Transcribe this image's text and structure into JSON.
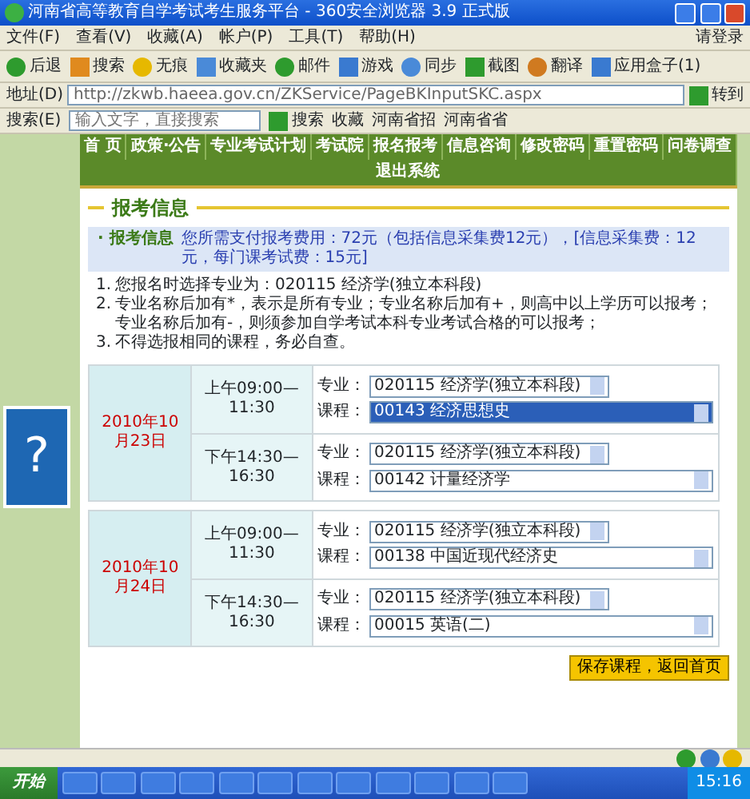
{
  "window": {
    "title": "河南省高等教育自学考试考生服务平台 - 360安全浏览器 3.9 正式版",
    "menu": [
      "文件(F)",
      "查看(V)",
      "收藏(A)",
      "帐户(P)",
      "工具(T)",
      "帮助(H)"
    ],
    "login": "请登录"
  },
  "toolbar": [
    {
      "label": "后退"
    },
    {
      "label": "搜索"
    },
    {
      "label": "无痕"
    },
    {
      "label": "收藏夹"
    },
    {
      "label": "邮件"
    },
    {
      "label": "游戏"
    },
    {
      "label": "同步"
    },
    {
      "label": "截图"
    },
    {
      "label": "翻译"
    },
    {
      "label": "应用盒子(1)"
    }
  ],
  "address": {
    "label": "地址(D)",
    "url": "http://zkwb.haeea.gov.cn/ZKService/PageBKInputSKC.aspx",
    "go": "转到"
  },
  "search_bar": {
    "label": "搜索(E)",
    "placeholder": "输入文字，直接搜索",
    "button": "搜索",
    "links": [
      "收藏",
      "河南省招",
      "河南省省"
    ]
  },
  "nav": [
    "首 页",
    "政策·公告",
    "专业考试计划",
    "考试院",
    "报名报考",
    "信息咨询",
    "修改密码",
    "重置密码",
    "问卷调查",
    "退出系统"
  ],
  "section_title": "报考信息",
  "info": {
    "heading": "· 报考信息",
    "fee_note": "您所需支付报考费用：72元（包括信息采集费12元），[信息采集费：12元，每门课考试费：15元]",
    "notes": [
      {
        "number": "1.",
        "text": "您报名时选择专业为：020115 经济学(独立本科段)"
      },
      {
        "number": "2.",
        "text": "专业名称后加有*，表示是所有专业；专业名称后加有+，则高中以上学历可以报考；专业名称后加有-，则须参加自学考试本科专业考试合格的可以报考；"
      },
      {
        "number": "3.",
        "text": "不得选报相同的课程，务必自查。"
      }
    ]
  },
  "exam_days": [
    {
      "date": "2010年10月23日",
      "sessions": [
        {
          "time": "上午09:00—11:30",
          "fields": [
            {
              "kind": "major",
              "label": "专业：",
              "value": "020115 经济学(独立本科段)",
              "highlighted": false
            },
            {
              "kind": "course",
              "label": "课程：",
              "value": "00143 经济思想史",
              "highlighted": true
            }
          ]
        },
        {
          "time": "下午14:30—16:30",
          "fields": [
            {
              "kind": "major",
              "label": "专业：",
              "value": "020115 经济学(独立本科段)",
              "highlighted": false
            },
            {
              "kind": "course",
              "label": "课程：",
              "value": "00142 计量经济学",
              "highlighted": false
            }
          ]
        }
      ]
    },
    {
      "date": "2010年10月24日",
      "sessions": [
        {
          "time": "上午09:00—11:30",
          "fields": [
            {
              "kind": "major",
              "label": "专业：",
              "value": "020115 经济学(独立本科段)",
              "highlighted": false
            },
            {
              "kind": "course",
              "label": "课程：",
              "value": "00138 中国近现代经济史",
              "highlighted": false
            }
          ]
        },
        {
          "time": "下午14:30—16:30",
          "fields": [
            {
              "kind": "major",
              "label": "专业：",
              "value": "020115 经济学(独立本科段)",
              "highlighted": false
            },
            {
              "kind": "course",
              "label": "课程：",
              "value": "00015 英语(二)",
              "highlighted": false
            }
          ]
        }
      ]
    }
  ],
  "save_button": "保存课程，返回首页",
  "help_icon": "?",
  "taskbar": {
    "start": "开始",
    "clock": "15:16"
  }
}
